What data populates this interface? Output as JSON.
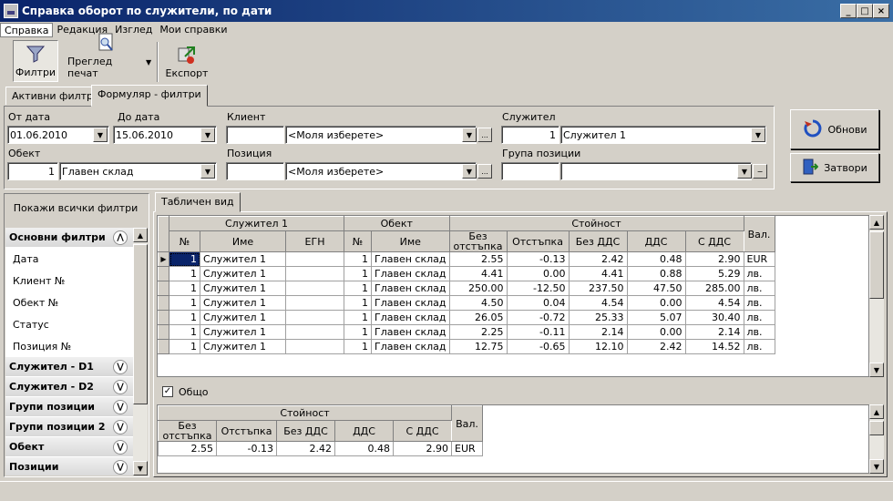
{
  "window": {
    "title": "Справка оборот по служители, по дати",
    "buttons": [
      "_",
      "□",
      "×"
    ]
  },
  "menu": [
    "Справка",
    "Редакция",
    "Изглед",
    "Мои справки"
  ],
  "toolbar": {
    "filters": "Филтри",
    "print_preview": "Преглед печат",
    "export": "Експорт"
  },
  "tabs": [
    "Активни филтри",
    "Формуляр - филтри"
  ],
  "form": {
    "from_date_label": "От дата",
    "from_date": "01.06.2010",
    "to_date_label": "До дата",
    "to_date": "15.06.2010",
    "client_label": "Клиент",
    "client_value": "<Моля изберете>",
    "employee_label": "Служител",
    "employee_id": "1",
    "employee_name": "Служител 1",
    "object_label": "Обект",
    "object_id": "1",
    "object_name": "Главен склад",
    "position_label": "Позиция",
    "position_value": "<Моля изберете>",
    "group_label": "Група позиции"
  },
  "buttons": {
    "refresh": "Обнови",
    "close": "Затвори",
    "dots": "..."
  },
  "sidebar": {
    "show_all": "Покажи всички филтри",
    "main_header": "Основни филтри",
    "items": [
      "Дата",
      "Клиент №",
      "Обект №",
      "Статус",
      "Позиция №"
    ],
    "groups": [
      "Служител - D1",
      "Служител - D2",
      "Групи позиции",
      "Групи позиции 2",
      "Обект",
      "Позиции"
    ]
  },
  "grid": {
    "tab": "Табличен вид",
    "headers": {
      "employee": "Служител 1",
      "object": "Обект",
      "value": "Стойност",
      "currency": "Вал.",
      "no": "№",
      "name": "Име",
      "egn": "ЕГН",
      "obj_no": "№",
      "obj_name": "Име",
      "no_disc": "Без отстъпка",
      "disc": "Отстъпка",
      "no_vat": "Без ДДС",
      "vat": "ДДС",
      "with_vat": "С ДДС"
    },
    "rows": [
      [
        "1",
        "Служител 1",
        "",
        "1",
        "Главен склад",
        "2.55",
        "-0.13",
        "2.42",
        "0.48",
        "2.90",
        "EUR"
      ],
      [
        "1",
        "Служител 1",
        "",
        "1",
        "Главен склад",
        "4.41",
        "0.00",
        "4.41",
        "0.88",
        "5.29",
        "лв."
      ],
      [
        "1",
        "Служител 1",
        "",
        "1",
        "Главен склад",
        "250.00",
        "-12.50",
        "237.50",
        "47.50",
        "285.00",
        "лв."
      ],
      [
        "1",
        "Служител 1",
        "",
        "1",
        "Главен склад",
        "4.50",
        "0.04",
        "4.54",
        "0.00",
        "4.54",
        "лв."
      ],
      [
        "1",
        "Служител 1",
        "",
        "1",
        "Главен склад",
        "26.05",
        "-0.72",
        "25.33",
        "5.07",
        "30.40",
        "лв."
      ],
      [
        "1",
        "Служител 1",
        "",
        "1",
        "Главен склад",
        "2.25",
        "-0.11",
        "2.14",
        "0.00",
        "2.14",
        "лв."
      ],
      [
        "1",
        "Служител 1",
        "",
        "1",
        "Главен склад",
        "12.75",
        "-0.65",
        "12.10",
        "2.42",
        "14.52",
        "лв."
      ]
    ]
  },
  "total": {
    "label": "Общо",
    "row": [
      "2.55",
      "-0.13",
      "2.42",
      "0.48",
      "2.90",
      "EUR"
    ]
  }
}
